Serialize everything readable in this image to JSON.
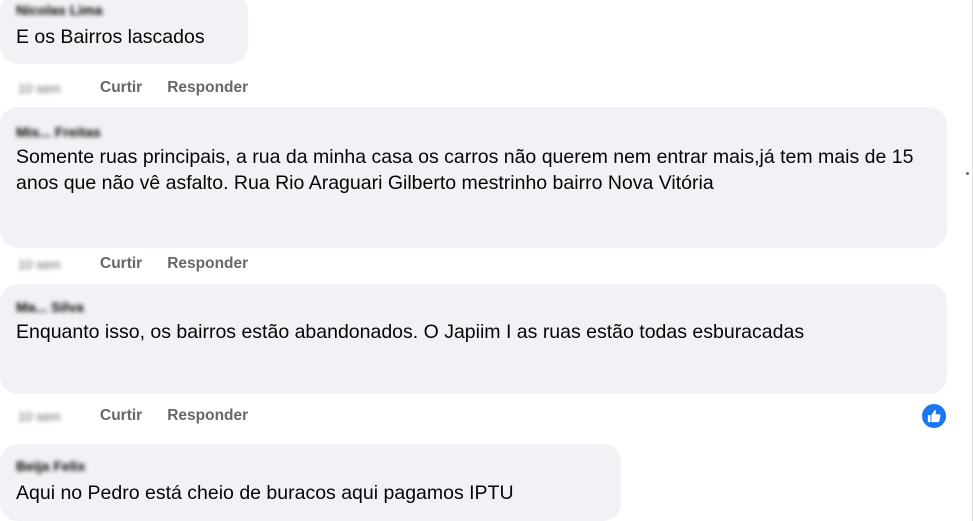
{
  "comments": [
    {
      "author": "Nicolas Lima",
      "text": "E os Bairros lascados",
      "time": "10 sem",
      "like_label": "Curtir",
      "reply_label": "Responder"
    },
    {
      "author": "Mis... Freitas",
      "text": "Somente ruas principais, a rua da minha casa os carros não querem nem entrar mais,já tem mais de 15 anos que não vê asfalto. Rua Rio Araguari Gilberto mestrinho bairro Nova Vitória",
      "time": "10 sem",
      "like_label": "Curtir",
      "reply_label": "Responder"
    },
    {
      "author": "Ma... Silva",
      "text": "Enquanto isso, os bairros estão abandonados. O Japiim I as ruas estão todas esburacadas",
      "time": "10 sem",
      "like_label": "Curtir",
      "reply_label": "Responder"
    },
    {
      "author": "Beija Felix",
      "text": "Aqui no Pedro está cheio de buracos aqui pagamos IPTU"
    }
  ],
  "icons": {
    "like_reaction": "thumbs-up-icon"
  },
  "colors": {
    "bubble_bg": "#f0f2f5",
    "action_text": "#65676b",
    "like_blue": "#1877f2"
  }
}
